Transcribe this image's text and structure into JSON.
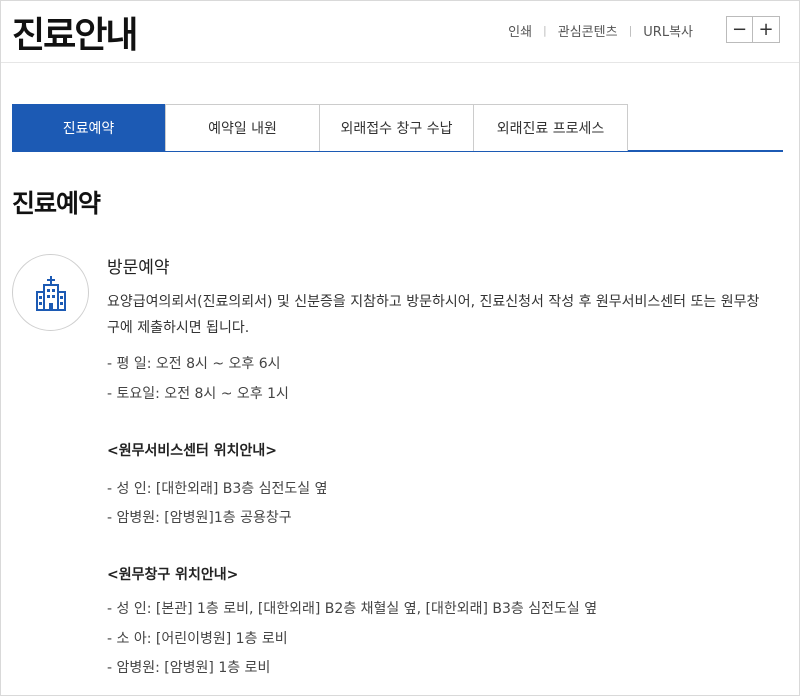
{
  "header": {
    "title": "진료안내",
    "utils": [
      "인쇄",
      "관심콘텐츠",
      "URL복사"
    ],
    "zoom_out": "−",
    "zoom_in": "+"
  },
  "tabs": [
    {
      "label": "진료예약",
      "active": true
    },
    {
      "label": "예약일 내원",
      "active": false
    },
    {
      "label": "외래접수 창구 수납",
      "active": false
    },
    {
      "label": "외래진료 프로세스",
      "active": false
    }
  ],
  "section": {
    "title": "진료예약",
    "icon": "hospital-icon",
    "subtitle": "방문예약",
    "description": "요양급여의뢰서(진료의뢰서) 및 신분증을 지참하고 방문하시어, 진료신청서 작성 후 원무서비스센터 또는 원무창구에 제출하시면 됩니다.",
    "hours": [
      "- 평  일: 오전 8시 ~ 오후 6시",
      "- 토요일: 오전 8시 ~ 오후 1시"
    ],
    "service_center": {
      "heading": "<원무서비스센터 위치안내>",
      "items": [
        "- 성  인: [대한외래] B3층 심전도실 옆",
        "- 암병원: [암병원]1층 공용창구"
      ]
    },
    "counter": {
      "heading": "<원무창구 위치안내>",
      "items": [
        "- 성  인: [본관] 1층 로비, [대한외래] B2층 채혈실 옆, [대한외래] B3층 심전도실 옆",
        "- 소  아: [어린이병원] 1층 로비",
        "- 암병원: [암병원] 1층 로비"
      ]
    }
  },
  "colors": {
    "accent": "#1c5ab4"
  }
}
